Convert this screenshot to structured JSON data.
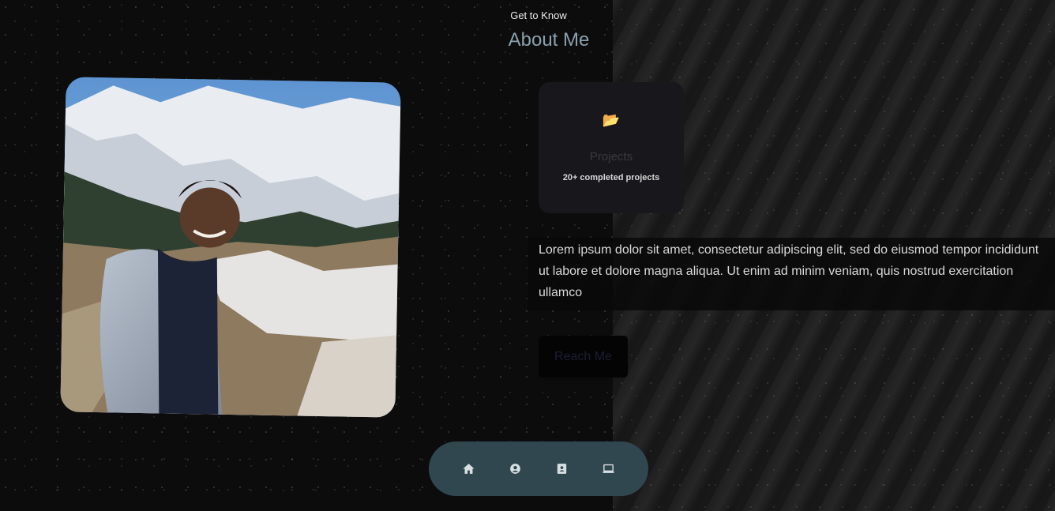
{
  "header": {
    "eyebrow": "Get to Know",
    "title": "About Me"
  },
  "photo": {
    "alt": "Portrait of a smiling man in a puffer vest in front of snowy mountains"
  },
  "card": {
    "icon": "folder-open-icon",
    "title": "Projects",
    "subtitle": "20+ completed projects"
  },
  "about": {
    "text": "Lorem ipsum dolor sit amet, consectetur adipiscing elit, sed do eiusmod tempor incididunt ut labore et dolore magna aliqua. Ut enim ad minim veniam, quis nostrud exercitation ullamco"
  },
  "cta": {
    "label": "Reach Me"
  },
  "nav": {
    "items": [
      {
        "icon": "home-icon"
      },
      {
        "icon": "user-circle-icon"
      },
      {
        "icon": "contact-book-icon"
      },
      {
        "icon": "laptop-icon"
      }
    ]
  },
  "colors": {
    "nav_background": "#31474f",
    "title": "#8aa0ad",
    "card_background": "#17171c"
  }
}
